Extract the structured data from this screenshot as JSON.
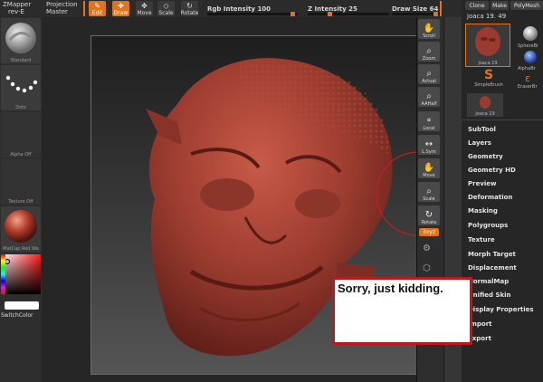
{
  "topbar": {
    "zmapper_line1": "ZMapper",
    "zmapper_line2": "rev-E",
    "projection_line1": "Projection",
    "projection_line2": "Master",
    "edit": "Edit",
    "draw": "Draw",
    "move": "Move",
    "scale": "Scale",
    "rotate": "Rotate",
    "rgb_label": "Rgb",
    "rgb_intensity_label": "Intensity",
    "rgb_intensity_value": "100",
    "z_label": "Z",
    "z_intensity_label": "Intensity",
    "z_intensity_value": "25",
    "draw_size_label": "Draw Size",
    "draw_size_value": "64"
  },
  "left_shelf": {
    "standard": "Standard",
    "dots": "Dots",
    "alpha": "Alpha Off",
    "texture": "Texture Off",
    "material": "MatCap Red Wa",
    "switch_color": "SwitchColor"
  },
  "right_tools": {
    "scroll": "Scroll",
    "zoom": "Zoom",
    "actual": "Actual",
    "aahalf": "AAHalf",
    "local": "Local",
    "lsym": "L.Sym",
    "move": "Move",
    "scale": "Scale",
    "rotate": "Rotate",
    "xyz": "Ǝxyz"
  },
  "tool_panel": {
    "clone": "Clone",
    "make": "Make",
    "polymesh": "PolyMesh",
    "current_tool": "joaca",
    "current_tool_count": "19. 49",
    "thumb_label": "joaca",
    "thumb_count": "19",
    "spherebrush": "SphereBr",
    "alphabrush": "AlphaBr",
    "simplebrush": "SimpleBrush",
    "eraserbrush": "EraserBr",
    "mini_label": "joaca",
    "mini_count": "19",
    "subpalettes": [
      "SubTool",
      "Layers",
      "Geometry",
      "Geometry HD",
      "Preview",
      "Deformation",
      "Masking",
      "Polygroups",
      "Texture",
      "Morph Target",
      "Displacement",
      "NormalMap",
      "Unified Skin",
      "Display Properties",
      "Import",
      "Export"
    ]
  },
  "popup": {
    "text": "Sorry, just kidding."
  },
  "colors": {
    "accent": "#e0741d",
    "model": "#9a3b2f",
    "popup_border": "#c01818"
  }
}
